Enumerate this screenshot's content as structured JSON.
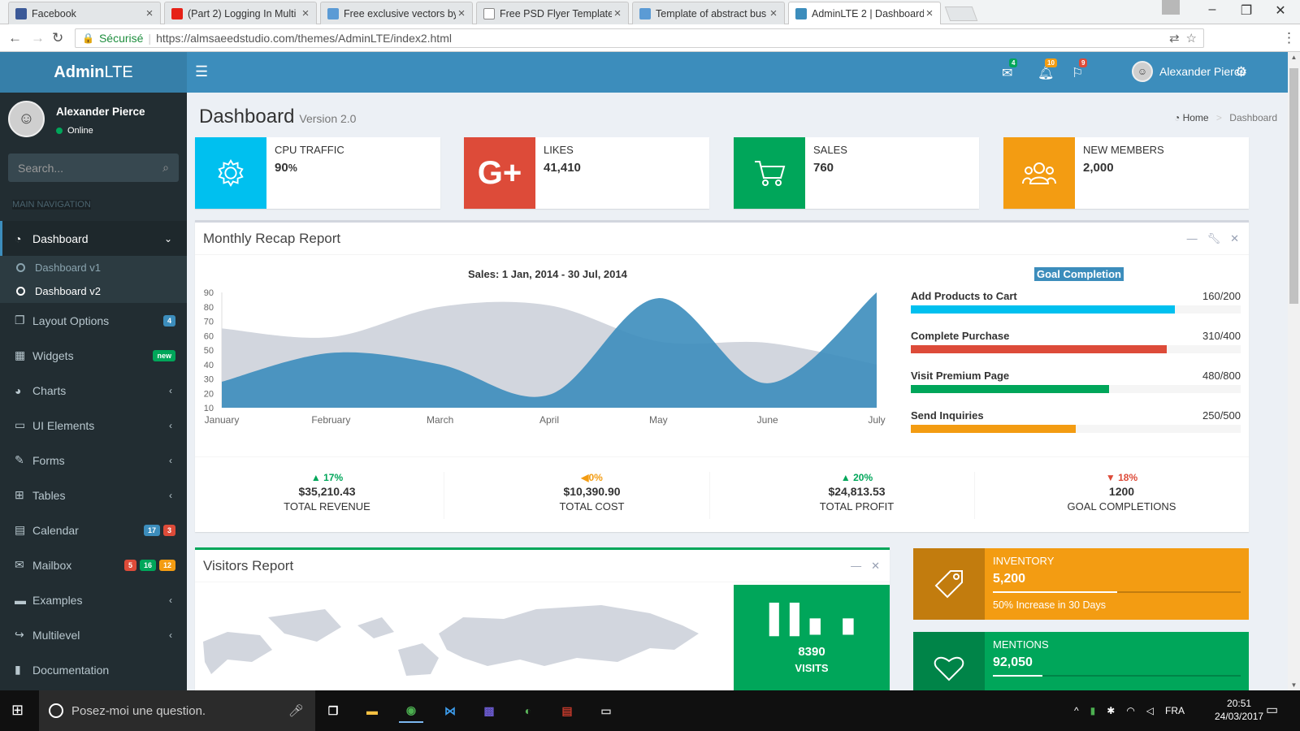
{
  "browser": {
    "tabs": [
      {
        "title": "Facebook",
        "favicon_color": "#3b5998"
      },
      {
        "title": "(Part 2) Logging In Multi",
        "favicon_color": "#e62117"
      },
      {
        "title": "Free exclusive vectors by",
        "favicon_color": "#5b9bd5"
      },
      {
        "title": "Free PSD Flyer Templates",
        "favicon_color": "#dddddd"
      },
      {
        "title": "Template of abstract bus",
        "favicon_color": "#5b9bd5"
      },
      {
        "title": "AdminLTE 2 | Dashboard",
        "favicon_color": "#3c8dbc"
      }
    ],
    "secure_label": "Sécurisé",
    "url": "https://almsaeedstudio.com/themes/AdminLTE/index2.html"
  },
  "app": {
    "logo_bold": "Admin",
    "logo_light": "LTE",
    "user_name": "Alexander Pierce",
    "nav_badges": {
      "messages": "4",
      "notifications": "10",
      "tasks": "9"
    }
  },
  "sidebar": {
    "user_name": "Alexander Pierce",
    "status": "Online",
    "search_placeholder": "Search...",
    "header": "MAIN NAVIGATION",
    "items": [
      {
        "label": "Dashboard",
        "icon": "dashboard-icon"
      },
      {
        "label": "Layout Options",
        "icon": "files-icon",
        "badges": [
          {
            "text": "4",
            "color": "#3c8dbc"
          }
        ]
      },
      {
        "label": "Widgets",
        "icon": "th-icon",
        "badges": [
          {
            "text": "new",
            "color": "#00a65a"
          }
        ]
      },
      {
        "label": "Charts",
        "icon": "pie-chart-icon"
      },
      {
        "label": "UI Elements",
        "icon": "laptop-icon"
      },
      {
        "label": "Forms",
        "icon": "edit-icon"
      },
      {
        "label": "Tables",
        "icon": "table-icon"
      },
      {
        "label": "Calendar",
        "icon": "calendar-icon",
        "badges": [
          {
            "text": "17",
            "color": "#3c8dbc"
          },
          {
            "text": "3",
            "color": "#dd4b39"
          }
        ]
      },
      {
        "label": "Mailbox",
        "icon": "envelope-icon",
        "badges": [
          {
            "text": "5",
            "color": "#dd4b39"
          },
          {
            "text": "16",
            "color": "#00a65a"
          },
          {
            "text": "12",
            "color": "#f39c12"
          }
        ]
      },
      {
        "label": "Examples",
        "icon": "folder-icon"
      },
      {
        "label": "Multilevel",
        "icon": "share-icon"
      },
      {
        "label": "Documentation",
        "icon": "book-icon"
      }
    ],
    "subitems": [
      "Dashboard v1",
      "Dashboard v2"
    ]
  },
  "page": {
    "title": "Dashboard",
    "subtitle": "Version 2.0",
    "breadcrumb_home": "Home",
    "breadcrumb_current": "Dashboard"
  },
  "info_boxes": [
    {
      "label": "CPU TRAFFIC",
      "value": "90",
      "unit": "%",
      "color": "#00c0ef",
      "icon": "gear-icon"
    },
    {
      "label": "LIKES",
      "value": "41,410",
      "unit": "",
      "color": "#dd4b39",
      "icon": "google-plus-icon"
    },
    {
      "label": "SALES",
      "value": "760",
      "unit": "",
      "color": "#00a65a",
      "icon": "shopping-cart-icon"
    },
    {
      "label": "NEW MEMBERS",
      "value": "2,000",
      "unit": "",
      "color": "#f39c12",
      "icon": "users-icon"
    }
  ],
  "recap": {
    "title": "Monthly Recap Report",
    "chart_title": "Sales: 1 Jan, 2014 - 30 Jul, 2014",
    "goal_title": "Goal Completion",
    "goals": [
      {
        "label": "Add Products to Cart",
        "value": "160/200",
        "fraction": 0.8,
        "color": "#00c0ef"
      },
      {
        "label": "Complete Purchase",
        "value": "310/400",
        "fraction": 0.775,
        "color": "#dd4b39"
      },
      {
        "label": "Visit Premium Page",
        "value": "480/800",
        "fraction": 0.6,
        "color": "#00a65a"
      },
      {
        "label": "Send Inquiries",
        "value": "250/500",
        "fraction": 0.5,
        "color": "#f39c12"
      }
    ],
    "stats": [
      {
        "pct": "17%",
        "dir": "up",
        "color": "#00a65a",
        "amount": "$35,210.43",
        "label": "TOTAL REVENUE"
      },
      {
        "pct": "0%",
        "dir": "left",
        "color": "#f39c12",
        "amount": "$10,390.90",
        "label": "TOTAL COST"
      },
      {
        "pct": "20%",
        "dir": "up",
        "color": "#00a65a",
        "amount": "$24,813.53",
        "label": "TOTAL PROFIT"
      },
      {
        "pct": "18%",
        "dir": "down",
        "color": "#dd4b39",
        "amount": "1200",
        "label": "GOAL COMPLETIONS"
      }
    ]
  },
  "chart_data": {
    "type": "area",
    "title": "Sales: 1 Jan, 2014 - 30 Jul, 2014",
    "categories": [
      "January",
      "February",
      "March",
      "April",
      "May",
      "June",
      "July"
    ],
    "series": [
      {
        "color": "#d2d6de",
        "values": [
          65,
          59,
          80,
          81,
          56,
          55,
          40
        ]
      },
      {
        "color": "#3c8dbc",
        "values": [
          28,
          48,
          40,
          19,
          86,
          27,
          90
        ]
      }
    ],
    "ylim": [
      10,
      90
    ],
    "yticks": [
      10,
      20,
      30,
      40,
      50,
      60,
      70,
      80,
      90
    ]
  },
  "visitors": {
    "title": "Visitors Report",
    "visits_value": "8390",
    "visits_label": "VISITS"
  },
  "side_boxes": [
    {
      "label": "INVENTORY",
      "value": "5,200",
      "desc": "50% Increase in 30 Days",
      "progress": 0.5,
      "color": "#f39c12",
      "icon": "tag-icon"
    },
    {
      "label": "MENTIONS",
      "value": "92,050",
      "desc": "",
      "progress": 0.2,
      "color": "#00a65a",
      "icon": "heart-icon"
    }
  ],
  "taskbar": {
    "search_placeholder": "Posez-moi une question.",
    "lang": "FRA",
    "time": "20:51",
    "date": "24/03/2017"
  }
}
